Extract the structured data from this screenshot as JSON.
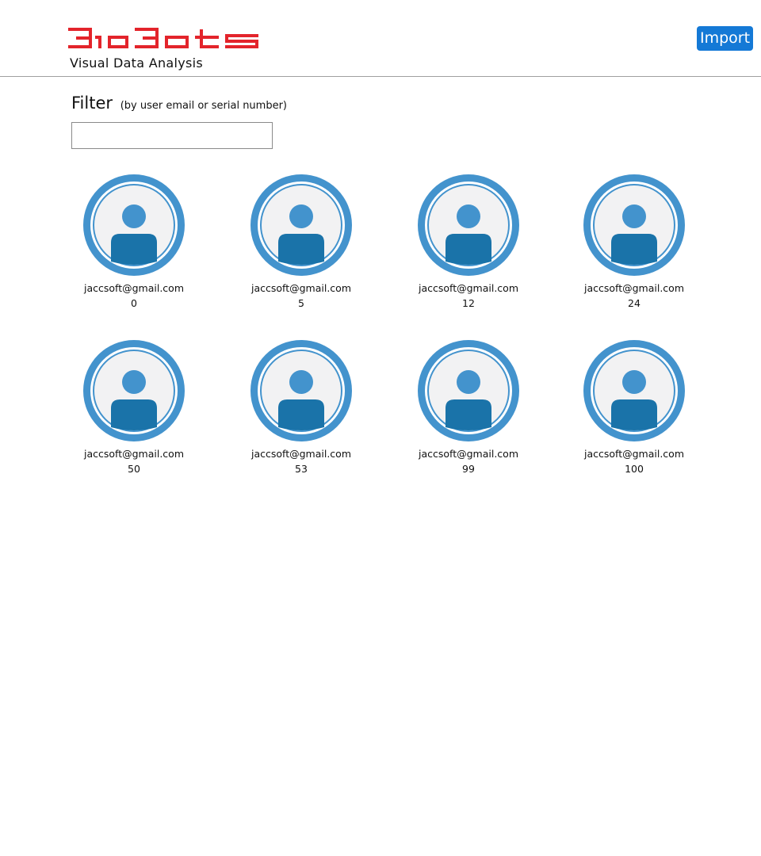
{
  "header": {
    "logo_text": "BioBots",
    "subtitle": "Visual Data Analysis",
    "import_label": "Import",
    "brand_color": "#e3242b",
    "accent_color": "#1479d6"
  },
  "filter": {
    "title": "Filter",
    "hint": "(by user email or serial number)",
    "value": "",
    "placeholder": ""
  },
  "devices": [
    {
      "email": "jaccsoft@gmail.com",
      "serial": "0",
      "icon": "user-avatar-icon"
    },
    {
      "email": "jaccsoft@gmail.com",
      "serial": "5",
      "icon": "user-avatar-icon"
    },
    {
      "email": "jaccsoft@gmail.com",
      "serial": "12",
      "icon": "user-avatar-icon"
    },
    {
      "email": "jaccsoft@gmail.com",
      "serial": "24",
      "icon": "user-avatar-icon"
    },
    {
      "email": "jaccsoft@gmail.com",
      "serial": "50",
      "icon": "user-avatar-icon"
    },
    {
      "email": "jaccsoft@gmail.com",
      "serial": "53",
      "icon": "user-avatar-icon"
    },
    {
      "email": "jaccsoft@gmail.com",
      "serial": "99",
      "icon": "user-avatar-icon"
    },
    {
      "email": "jaccsoft@gmail.com",
      "serial": "100",
      "icon": "user-avatar-icon"
    }
  ]
}
